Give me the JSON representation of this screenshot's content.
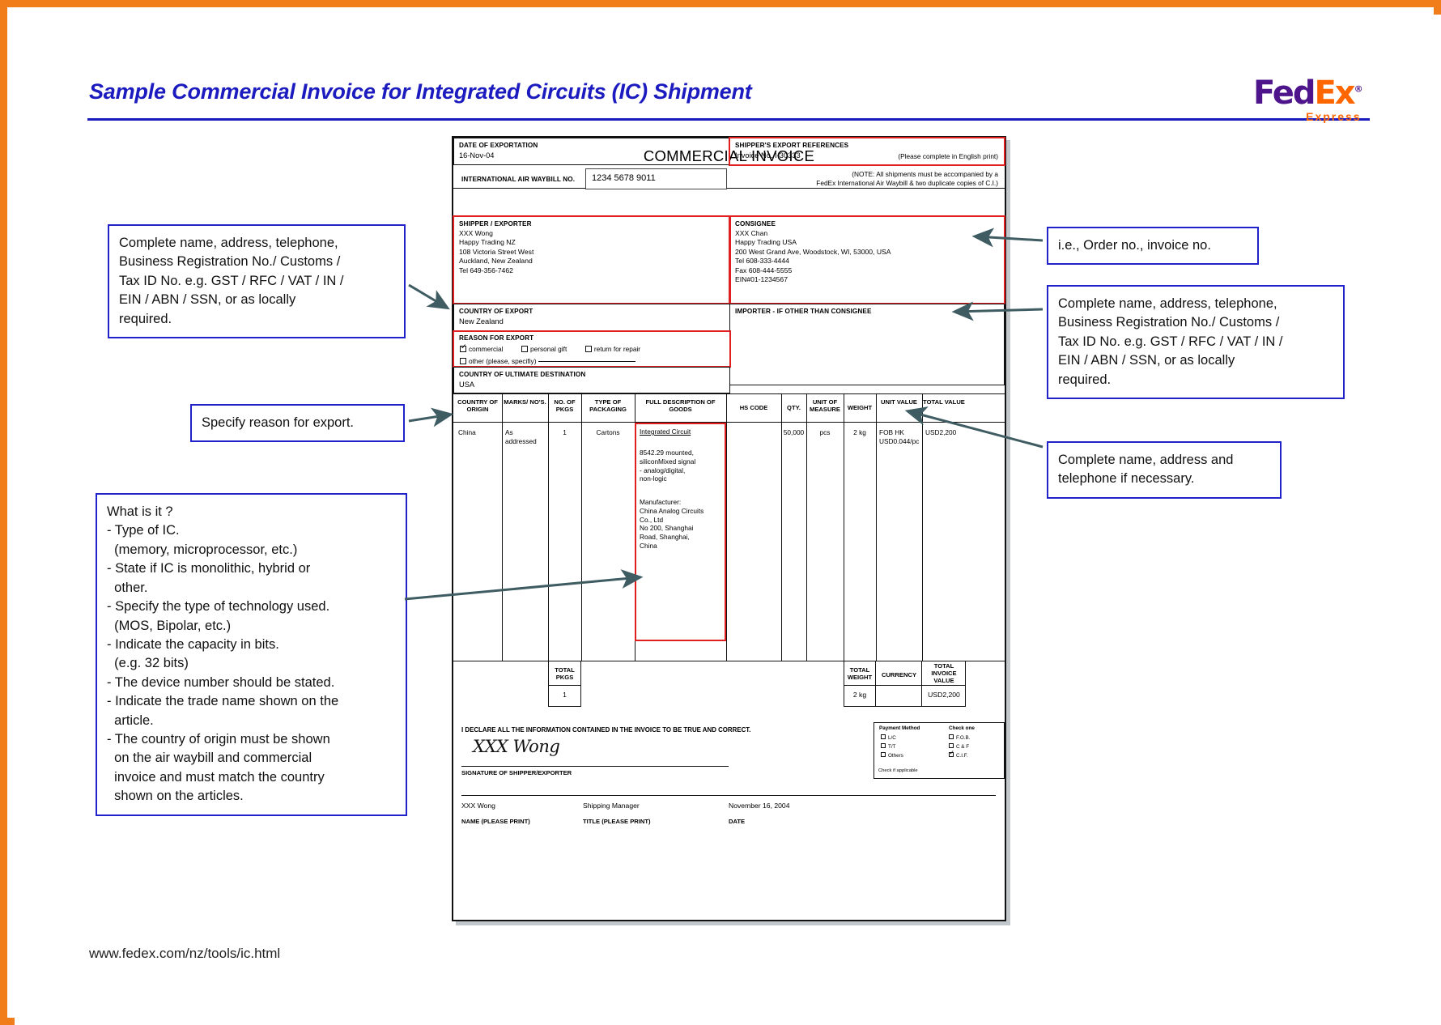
{
  "header": {
    "title": "Sample Commercial Invoice for Integrated Circuits (IC) Shipment",
    "logo_fed": "Fed",
    "logo_ex": "Ex",
    "logo_reg": "®",
    "logo_sub": "Express",
    "footer_url": "www.fedex.com/nz/tools/ic.html"
  },
  "invoice": {
    "title": "COMMERCIAL INVOICE",
    "please_complete": "(Please complete in English print)",
    "awb_label": "INTERNATIONAL AIR WAYBILL NO.",
    "awb_value": "1234 5678 9011",
    "awb_note_line1": "(NOTE: All shipments must be accompanied by a",
    "awb_note_line2": "FedEx International Air Waybill & two duplicate copies of C.I.)",
    "date_of_exportation_label": "DATE OF EXPORTATION",
    "date_of_exportation_value": "16-Nov-04",
    "export_refs_label": "SHIPPER'S EXPORT REFERENCES",
    "export_refs_value": "Invoice No. I-30333",
    "shipper_label": "SHIPPER / EXPORTER",
    "shipper_lines": [
      "XXX Wong",
      "Happy Trading NZ",
      "108 Victoria Street West",
      "Auckland, New Zealand",
      "Tel 649-356-7462"
    ],
    "consignee_label": "CONSIGNEE",
    "consignee_lines": [
      "XXX Chan",
      "Happy Trading USA",
      "200 West Grand Ave, Woodstock, WI, 53000, USA",
      "Tel 608-333-4444",
      "Fax 608-444-5555",
      "EIN#01-1234567"
    ],
    "country_of_export_label": "COUNTRY OF EXPORT",
    "country_of_export_value": "New Zealand",
    "importer_label": "IMPORTER - IF OTHER THAN CONSIGNEE",
    "importer_value": "",
    "reason_label": "REASON FOR EXPORT",
    "reason_options": [
      {
        "label": "commercial",
        "checked": true
      },
      {
        "label": "personal gift",
        "checked": false
      },
      {
        "label": "return for repair",
        "checked": false
      },
      {
        "label": "other (please, specifiy)",
        "checked": false
      }
    ],
    "destination_label": "COUNTRY OF ULTIMATE DESTINATION",
    "destination_value": "USA",
    "table_headers": [
      "COUNTRY\nOF ORIGIN",
      "MARKS/\nNO'S.",
      "NO. OF\nPKGS",
      "TYPE OF\nPACKAGING",
      "FULL DESCRIPTION\nOF GOODS",
      "HS CODE",
      "QTY.",
      "UNIT OF\nMEASURE",
      "WEIGHT",
      "UNIT\nVALUE",
      "TOTAL\nVALUE"
    ],
    "row": {
      "country_of_origin": "China",
      "marks_nos": "As\naddressed",
      "no_of_pkgs": "1",
      "type_of_packaging": "Cartons",
      "description_title": "Integrated Circuit",
      "description_block1": "8542.29 mounted,\nsiliconMixed signal\n- analog/digital,\nnon-logic",
      "description_block2": "Manufacturer:\nChina Analog Circuits\nCo., Ltd\nNo 200, Shanghai\nRoad, Shanghai,\nChina",
      "hs_code": "",
      "qty": "50,000",
      "unit_of_measure": "pcs",
      "weight": "2 kg",
      "unit_value": "FOB HK\nUSD0.044/pc",
      "total_value": "USD2,200"
    },
    "totals": {
      "total_pkgs_label": "TOTAL\nPKGS",
      "total_pkgs_value": "1",
      "total_weight_label": "TOTAL\nWEIGHT",
      "total_weight_value": "2 kg",
      "currency_label": "CURRENCY",
      "currency_value": "",
      "total_invoice_value_label": "TOTAL\nINVOICE\nVALUE",
      "total_invoice_value": "USD2,200"
    },
    "payment": {
      "method_title": "Payment Method",
      "check_one_title": "Check one",
      "methods": [
        {
          "label": "L/C",
          "checked": false
        },
        {
          "label": "T/T",
          "checked": false
        },
        {
          "label": "Others",
          "checked": false
        }
      ],
      "terms": [
        {
          "label": "F.O.B.",
          "checked": false
        },
        {
          "label": "C & F",
          "checked": false
        },
        {
          "label": "C.I.F.",
          "checked": true
        }
      ],
      "footnote": "Check if applicable"
    },
    "declaration": "I DECLARE ALL THE INFORMATION CONTAINED IN THE INVOICE TO BE TRUE AND CORRECT.",
    "signature": "XXX Wong",
    "signature_label": "SIGNATURE OF SHIPPER/EXPORTER",
    "footer_name_value": "XXX Wong",
    "footer_name_label": "NAME (PLEASE PRINT)",
    "footer_title_value": "Shipping Manager",
    "footer_title_label": "TITLE (PLEASE PRINT)",
    "footer_date_value": "November 16, 2004",
    "footer_date_label": "DATE"
  },
  "callouts": {
    "shipper_note": "Complete name, address, telephone,\nBusiness Registration No./ Customs /\nTax ID No. e.g. GST / RFC / VAT / IN /\nEIN / ABN / SSN, or as locally\nrequired.",
    "reason_note": "Specify reason for export.",
    "goods_note": "What is it ?\n- Type of IC.\n  (memory, microprocessor, etc.)\n- State if IC is monolithic, hybrid or\n  other.\n- Specify the type of technology used.\n  (MOS, Bipolar, etc.)\n- Indicate the capacity in bits.\n  (e.g. 32 bits)\n- The device number should be stated.\n- Indicate the trade name shown on the\n  article.\n- The country of origin must be shown\n  on the air waybill and commercial\n  invoice and must match the country\n  shown on the articles.",
    "refs_note": "i.e., Order no., invoice no.",
    "consignee_note": "Complete name, address, telephone,\nBusiness Registration No./ Customs /\nTax ID No. e.g. GST / RFC / VAT / IN /\nEIN / ABN / SSN, or as locally\nrequired.",
    "importer_note": "Complete name, address and\ntelephone if necessary."
  },
  "colors": {
    "page_border": "#f07c1a",
    "title_blue": "#1b1bbf",
    "callout_blue": "#2222cc",
    "highlight_red": "#e02020",
    "fedex_purple": "#4d148c",
    "fedex_orange": "#ff6600",
    "arrow_gray": "#3f5c63"
  }
}
